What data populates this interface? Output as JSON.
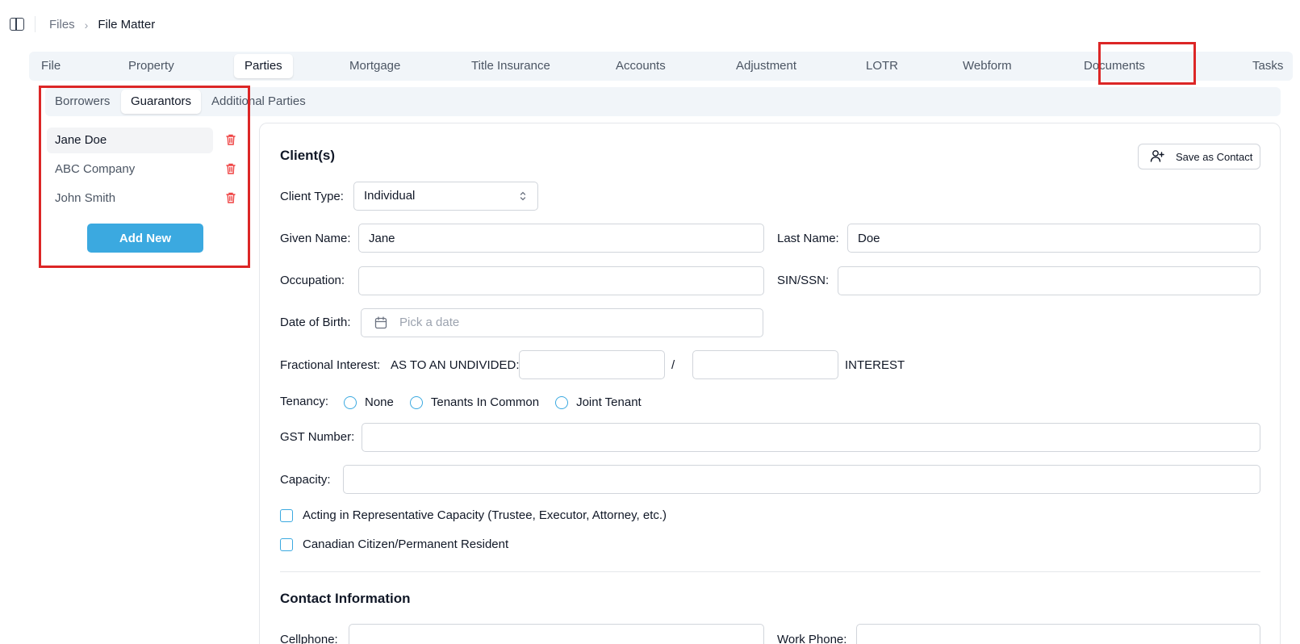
{
  "breadcrumb": {
    "root": "Files",
    "separator": "›",
    "current": "File Matter"
  },
  "main_tabs": [
    {
      "label": "File"
    },
    {
      "label": "Property"
    },
    {
      "label": "Parties"
    },
    {
      "label": "Mortgage"
    },
    {
      "label": "Title Insurance"
    },
    {
      "label": "Accounts"
    },
    {
      "label": "Adjustment"
    },
    {
      "label": "LOTR"
    },
    {
      "label": "Webform"
    },
    {
      "label": "Documents"
    },
    {
      "label": "Tasks"
    }
  ],
  "active_main_tab": "Parties",
  "sub_tabs": [
    {
      "label": "Borrowers"
    },
    {
      "label": "Guarantors"
    },
    {
      "label": "Additional Parties"
    }
  ],
  "active_sub_tab": "Guarantors",
  "parties": [
    {
      "name": "Jane Doe"
    },
    {
      "name": "ABC Company"
    },
    {
      "name": "John Smith"
    }
  ],
  "selected_party": "Jane Doe",
  "add_new_label": "Add New",
  "form": {
    "clients_title": "Client(s)",
    "save_contact_label": "Save as Contact",
    "client_type_label": "Client Type:",
    "client_type_value": "Individual",
    "given_name_label": "Given Name:",
    "given_name_value": "Jane",
    "last_name_label": "Last Name:",
    "last_name_value": "Doe",
    "occupation_label": "Occupation:",
    "occupation_value": "",
    "sin_label": "SIN/SSN:",
    "sin_value": "",
    "dob_label": "Date of Birth:",
    "dob_placeholder": "Pick a date",
    "fractional_label": "Fractional Interest:",
    "undivided_label": "AS TO AN UNDIVIDED:",
    "fraction_numerator": "",
    "fraction_slash": "/",
    "fraction_denominator": "",
    "interest_label": "INTEREST",
    "tenancy_label": "Tenancy:",
    "tenancy_options": [
      {
        "label": "None"
      },
      {
        "label": "Tenants In Common"
      },
      {
        "label": "Joint Tenant"
      }
    ],
    "gst_label": "GST Number:",
    "gst_value": "",
    "capacity_label": "Capacity:",
    "capacity_value": "",
    "representative_label": "Acting in Representative Capacity (Trustee, Executor, Attorney, etc.)",
    "citizen_label": "Canadian Citizen/Permanent Resident",
    "contact_title": "Contact Information",
    "cellphone_label": "Cellphone:",
    "cellphone_value": "",
    "work_phone_label": "Work Phone:",
    "work_phone_value": ""
  },
  "colors": {
    "accent": "#3ba9e0",
    "highlight": "#dc2626",
    "delete": "#ef4444",
    "tab_bg": "#f1f5f9"
  }
}
